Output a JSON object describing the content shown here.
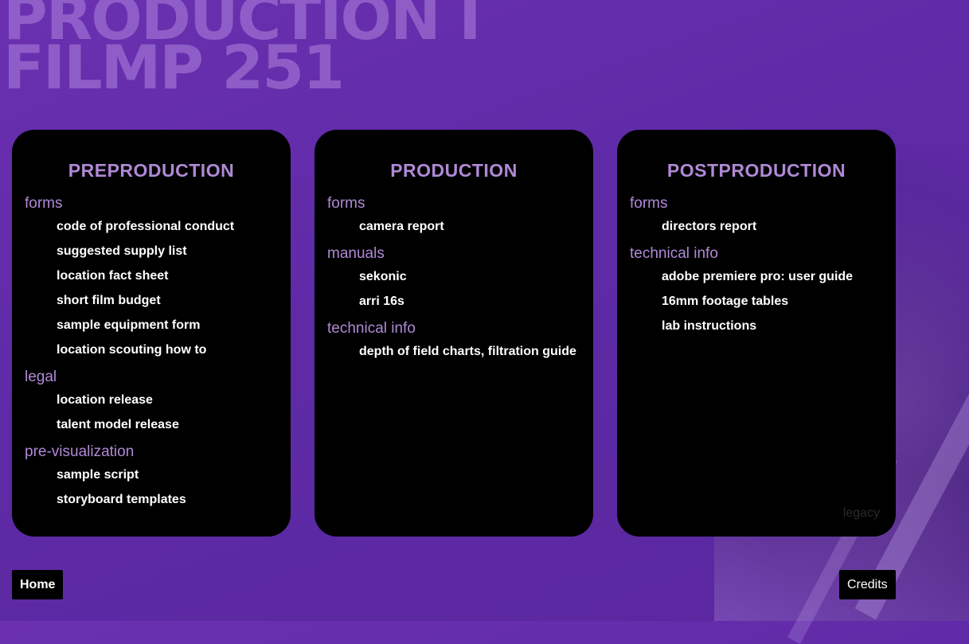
{
  "header": {
    "line1": "PRODUCTION I",
    "line2": "FILMP 251"
  },
  "panels": {
    "pre": {
      "title": "PREPRODUCTION",
      "forms_label": "forms",
      "forms": [
        "code of professional conduct",
        "suggested supply list",
        "location fact sheet",
        "short film budget",
        "sample equipment form",
        "location scouting how to"
      ],
      "legal_label": "legal",
      "legal": [
        "location release",
        "talent model release"
      ],
      "previs_label": "pre-visualization",
      "previs": [
        "sample script",
        "storyboard templates"
      ]
    },
    "prod": {
      "title": "PRODUCTION",
      "forms_label": "forms",
      "forms": [
        "camera report"
      ],
      "manuals_label": "manuals",
      "manuals": [
        "sekonic",
        "arri 16s"
      ],
      "tech_label": "technical info",
      "tech": [
        "depth of field charts, filtration guide"
      ]
    },
    "post": {
      "title": "POSTPRODUCTION",
      "forms_label": "forms",
      "forms": [
        "directors report"
      ],
      "tech_label": "technical info",
      "tech": [
        "adobe premiere pro: user guide",
        "16mm footage tables",
        "lab instructions"
      ],
      "legacy": "legacy"
    }
  },
  "footer": {
    "home": "Home",
    "credits": "Credits"
  }
}
